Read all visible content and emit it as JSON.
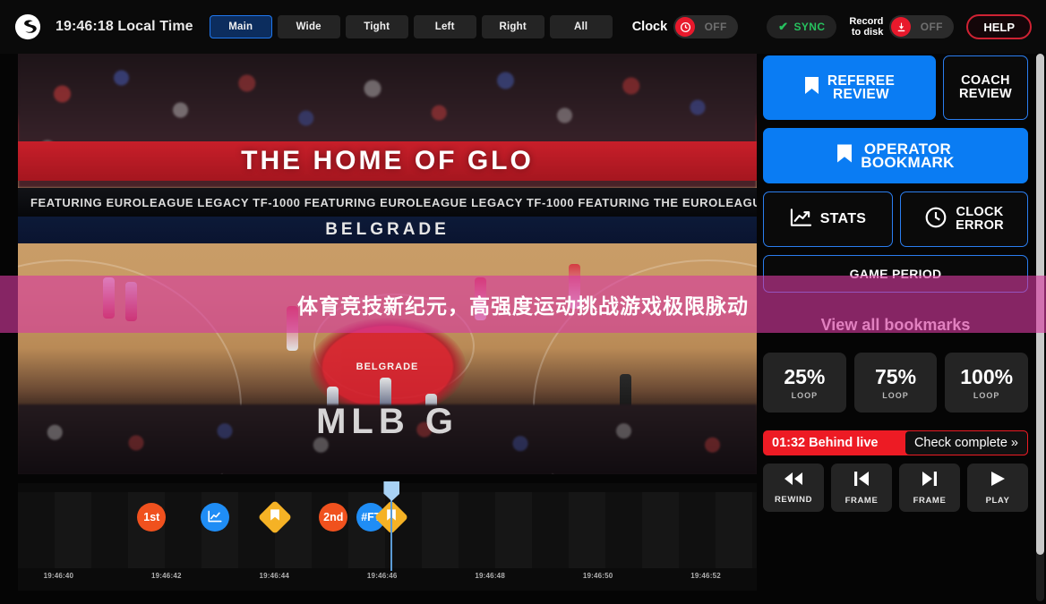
{
  "topbar": {
    "logo_icon": "euroleague-logo-icon",
    "local_time": "19:46:18 Local Time",
    "camera_tabs": [
      {
        "label": "Main",
        "active": true
      },
      {
        "label": "Wide",
        "active": false
      },
      {
        "label": "Tight",
        "active": false
      },
      {
        "label": "Left",
        "active": false
      },
      {
        "label": "Right",
        "active": false
      },
      {
        "label": "All",
        "active": false
      }
    ],
    "clock_toggle": {
      "label": "Clock",
      "state": "OFF",
      "icon": "clock-icon",
      "knob_color": "#e8192c"
    },
    "sync": {
      "label": "SYNC",
      "icon": "check-icon",
      "color": "#27c15e"
    },
    "record": {
      "line1": "Record",
      "line2": "to disk",
      "state": "OFF",
      "icon": "download-icon"
    },
    "help": {
      "label": "HELP"
    }
  },
  "video": {
    "led_text": "THE HOME OF GLO",
    "sponsor_ticker": "FEATURING EUROLEAGUE LEGACY TF-1000   FEATURING EUROLEAGUE LEGACY TF-1000   FEATURING THE EUROLEAGUE",
    "venue_text": "BELGRADE",
    "center_logo_text": "BELGRADE",
    "bottom_text": "MLB G"
  },
  "banner": {
    "text": "体育竞技新纪元，高强度运动挑战游戏极限脉动",
    "color": "#d63aa0"
  },
  "right_panel": {
    "referee_review": {
      "label_line1": "REFEREE",
      "label_line2": "REVIEW",
      "icon": "bookmark-icon"
    },
    "coach_review": {
      "label_line1": "COACH",
      "label_line2": "REVIEW"
    },
    "operator_bookmark": {
      "label_line1": "OPERATOR",
      "label_line2": "BOOKMARK",
      "icon": "bookmark-icon"
    },
    "stats": {
      "label": "STATS",
      "icon": "chart-icon"
    },
    "clock_error": {
      "label_line1": "CLOCK",
      "label_line2": "ERROR",
      "icon": "clock-icon"
    },
    "game_period": {
      "label": "GAME PERIOD"
    },
    "view_all_bookmarks": "View all bookmarks",
    "loops": [
      {
        "pct": "25%",
        "sub": "LOOP"
      },
      {
        "pct": "75%",
        "sub": "LOOP"
      },
      {
        "pct": "100%",
        "sub": "LOOP"
      }
    ],
    "behind_live": "01:32 Behind live",
    "check_complete": "Check complete »",
    "transport": [
      {
        "label": "REWIND",
        "icon": "rewind-icon"
      },
      {
        "label": "FRAME",
        "icon": "prev-frame-icon"
      },
      {
        "label": "FRAME",
        "icon": "next-frame-icon"
      },
      {
        "label": "PLAY",
        "icon": "play-icon"
      }
    ]
  },
  "timeline": {
    "markers": [
      {
        "type": "circle",
        "label": "1st",
        "color": "#f0511e",
        "left_pct": 18.1,
        "icon": ""
      },
      {
        "type": "circle",
        "label": "",
        "color": "#1f8df5",
        "left_pct": 26.7,
        "icon": "chart-icon"
      },
      {
        "type": "diamond",
        "label": "",
        "color": "#f5b225",
        "left_pct": 34.8,
        "icon": "bookmark-icon"
      },
      {
        "type": "circle",
        "label": "2nd",
        "color": "#f0511e",
        "left_pct": 42.7,
        "icon": ""
      },
      {
        "type": "circle",
        "label": "#FT",
        "color": "#1f8df5",
        "left_pct": 47.8,
        "icon": ""
      },
      {
        "type": "diamond",
        "label": "",
        "color": "#f5b225",
        "left_pct": 50.6,
        "icon": "bookmark-icon"
      }
    ],
    "playhead_pct": 50.6,
    "times": [
      {
        "label": "19:46:40",
        "left_pct": 5.5
      },
      {
        "label": "19:46:42",
        "left_pct": 20.1
      },
      {
        "label": "19:46:44",
        "left_pct": 34.7
      },
      {
        "label": "19:46:46",
        "left_pct": 49.3
      },
      {
        "label": "19:46:48",
        "left_pct": 63.9
      },
      {
        "label": "19:46:50",
        "left_pct": 78.5
      },
      {
        "label": "19:46:52",
        "left_pct": 93.1
      }
    ]
  }
}
